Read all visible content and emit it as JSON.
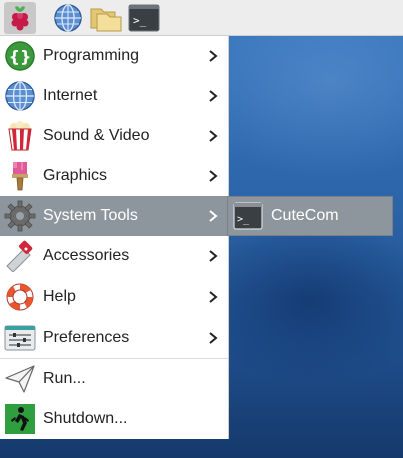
{
  "taskbar": {
    "buttons": [
      {
        "icon": "raspberry-pi-menu-icon"
      },
      {
        "icon": "web-browser-globe-icon"
      },
      {
        "icon": "file-manager-folder-icon"
      },
      {
        "icon": "terminal-icon",
        "glyph": ">_"
      }
    ]
  },
  "menu": {
    "items": [
      {
        "label": "Programming",
        "icon": "programming-braces-icon",
        "glyph": "{}"
      },
      {
        "label": "Internet",
        "icon": "internet-globe-icon"
      },
      {
        "label": "Sound & Video",
        "icon": "sound-video-popcorn-icon"
      },
      {
        "label": "Graphics",
        "icon": "graphics-brush-icon"
      },
      {
        "label": "System Tools",
        "icon": "system-tools-gear-icon",
        "selected": true
      },
      {
        "label": "Accessories",
        "icon": "accessories-knife-icon"
      },
      {
        "label": "Help",
        "icon": "help-lifebuoy-icon"
      },
      {
        "label": "Preferences",
        "icon": "preferences-sliders-icon"
      },
      {
        "label": "Run...",
        "icon": "run-paper-plane-icon"
      },
      {
        "label": "Shutdown...",
        "icon": "shutdown-exit-icon"
      }
    ]
  },
  "submenu": {
    "items": [
      {
        "label": "CuteCom",
        "icon": "cutecom-terminal-icon",
        "glyph": ">_"
      }
    ]
  },
  "colors": {
    "selected_background": "#8e969d",
    "desktop_blue": "#2c64a8",
    "menu_background": "#ffffff"
  }
}
